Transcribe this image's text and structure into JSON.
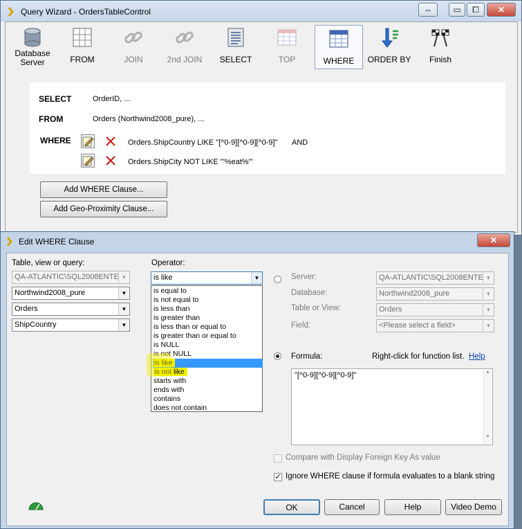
{
  "wizard": {
    "title": "Query Wizard - OrdersTableControl",
    "window_buttons": [
      "⇔",
      "▭",
      "⧠",
      "✕"
    ],
    "toolbar": [
      {
        "key": "database",
        "label_line1": "Database",
        "label_line2": "Server",
        "icon": "database-icon"
      },
      {
        "key": "from",
        "label": "FROM",
        "icon": "grid-icon"
      },
      {
        "key": "join",
        "label": "JOIN",
        "icon": "chain-link-icon"
      },
      {
        "key": "second_join",
        "label": "2nd JOIN",
        "icon": "chain-link-icon"
      },
      {
        "key": "select",
        "label": "SELECT",
        "icon": "list-icon"
      },
      {
        "key": "top",
        "label": "TOP",
        "icon": "table-icon"
      },
      {
        "key": "where",
        "label": "WHERE",
        "icon": "filter-grid-icon"
      },
      {
        "key": "order_by",
        "label": "ORDER BY",
        "icon": "sort-arrow-icon"
      },
      {
        "key": "finish",
        "label": "Finish",
        "icon": "checkered-flags-icon"
      }
    ],
    "sql": {
      "select_kw": "SELECT",
      "select_text": "OrderID, ...",
      "from_kw": "FROM",
      "from_text": "Orders (Northwind2008_pure), ...",
      "where_kw": "WHERE",
      "clause1": "Orders.ShipCountry LIKE \"[^0-9][^0-9][^0-9]\"",
      "and_kw": "AND",
      "clause2": "Orders.ShipCity NOT LIKE \"'%eat%'\""
    },
    "add_where_button": "Add WHERE Clause...",
    "add_geo_button": "Add Geo-Proximity Clause..."
  },
  "dialog": {
    "title": "Edit WHERE Clause",
    "left": {
      "label": "Table, view or query:",
      "server": "QA-ATLANTIC\\SQL2008ENTE",
      "database": "Northwind2008_pure",
      "table": "Orders",
      "field": "ShipCountry"
    },
    "operator": {
      "label": "Operator:",
      "selected": "is like",
      "options": [
        "is equal to",
        "is not equal to",
        "is less than",
        "is greater than",
        "is less than or equal to",
        "is greater than or equal to",
        "is NULL",
        "is not NULL",
        "is like",
        "is not like",
        "starts with",
        "ends with",
        "contains",
        "does not contain"
      ]
    },
    "right": {
      "server_label": "Server:",
      "server_value": "QA-ATLANTIC\\SQL2008ENTE",
      "database_label": "Database:",
      "database_value": "Northwind2008_pure",
      "table_label": "Table or View:",
      "table_value": "Orders",
      "field_label": "Field:",
      "field_value": "<Please select a field>",
      "formula_label": "Formula:",
      "hint": "Right-click for function list.",
      "help_link": "Help",
      "formula_value": "\"[^0-9][^0-9][^0-9]\""
    },
    "compare_fk": "Compare with Display Foreign Key As value",
    "ignore_blank": "Ignore WHERE clause if formula evaluates to a blank string",
    "buttons": {
      "ok": "OK",
      "cancel": "Cancel",
      "help": "Help",
      "video": "Video Demo"
    },
    "close": "✕"
  }
}
